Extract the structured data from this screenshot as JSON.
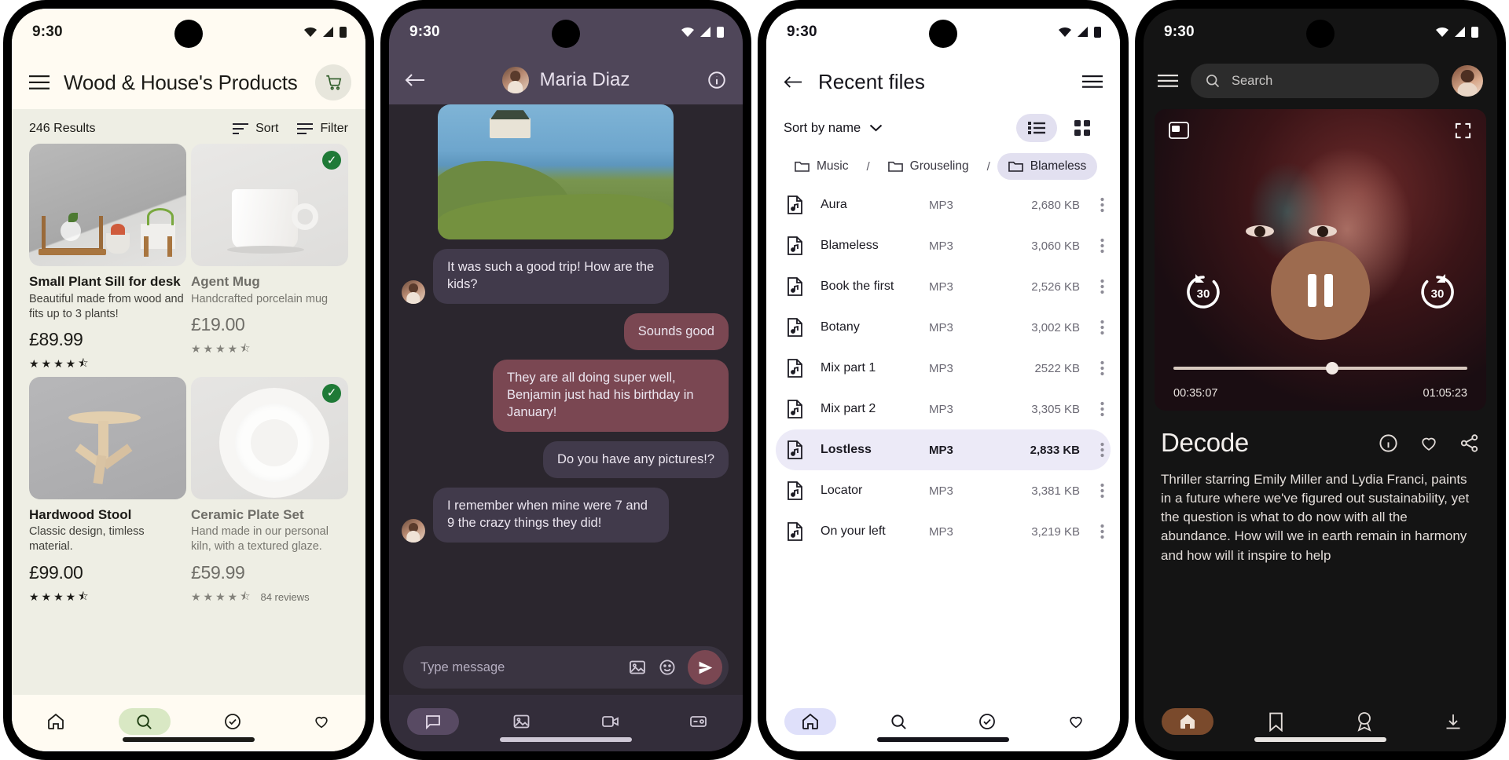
{
  "shop": {
    "status": {
      "time": "9:30"
    },
    "title": "Wood & House's Products",
    "cart_icon": "shopping-cart-icon",
    "menu_icon": "hamburger-menu-icon",
    "results_count": "246 Results",
    "sort_label": "Sort",
    "filter_label": "Filter",
    "products": [
      {
        "name": "Small Plant Sill for desk",
        "desc": "Beautiful made from wood and fits up to 3 plants!",
        "price": "£89.99",
        "stars": "★★★★",
        "half": "⯪",
        "selected": false,
        "reviews": ""
      },
      {
        "name": "Agent Mug",
        "desc": "Handcrafted porcelain mug",
        "price": "£19.00",
        "stars": "★★★★",
        "half": "⯪",
        "selected": true,
        "reviews": ""
      },
      {
        "name": "Hardwood Stool",
        "desc": "Classic design, timless material.",
        "price": "£99.00",
        "stars": "★★★★",
        "half": "⯪",
        "selected": false,
        "reviews": ""
      },
      {
        "name": "Ceramic Plate Set",
        "desc": "Hand made in our personal kiln, with a textured glaze.",
        "price": "£59.99",
        "stars": "★★★★",
        "half": "⯪",
        "selected": true,
        "reviews": "84 reviews"
      }
    ],
    "nav": [
      {
        "name": "home",
        "icon": "home-icon",
        "active": false
      },
      {
        "name": "search",
        "icon": "search-icon",
        "active": true
      },
      {
        "name": "orders",
        "icon": "check-circle-icon",
        "active": false
      },
      {
        "name": "favorites",
        "icon": "heart-icon",
        "active": false
      }
    ]
  },
  "chat": {
    "status": {
      "time": "9:30"
    },
    "contact": "Maria Diaz",
    "back_icon": "back-arrow-icon",
    "info_icon": "info-icon",
    "messages": [
      {
        "kind": "image",
        "side": "in"
      },
      {
        "kind": "text",
        "side": "in",
        "text": "It was such a good trip! How are the kids?"
      },
      {
        "kind": "text",
        "side": "out",
        "text": "Sounds good"
      },
      {
        "kind": "text",
        "side": "out",
        "text": "They are all doing super well, Benjamin just had his birthday in January!"
      },
      {
        "kind": "text",
        "side": "out",
        "text": "Do you have any pictures!?"
      },
      {
        "kind": "text",
        "side": "in",
        "text": "I remember when mine were 7 and 9 the crazy things they did!"
      }
    ],
    "composer": {
      "placeholder": "Type message",
      "image_icon": "image-icon",
      "emoji_icon": "emoji-icon",
      "send_icon": "send-icon"
    },
    "nav": [
      {
        "name": "chat",
        "icon": "chat-bubble-icon",
        "active": true
      },
      {
        "name": "photos",
        "icon": "image-icon",
        "active": false
      },
      {
        "name": "video",
        "icon": "video-camera-icon",
        "active": false
      },
      {
        "name": "payments",
        "icon": "wallet-icon",
        "active": false
      }
    ]
  },
  "files": {
    "status": {
      "time": "9:30"
    },
    "title": "Recent files",
    "back_icon": "back-arrow-icon",
    "menu_icon": "hamburger-menu-icon",
    "sort_label": "Sort by name",
    "sort_chevron": "chevron-down-icon",
    "view_list_icon": "list-view-icon",
    "view_grid_icon": "grid-view-icon",
    "view_mode": "list",
    "breadcrumbs": [
      {
        "label": "Music",
        "active": false
      },
      {
        "label": "Grouseling",
        "active": false
      },
      {
        "label": "Blameless",
        "active": true
      }
    ],
    "breadcrumb_sep": "/",
    "rows": [
      {
        "name": "Aura",
        "type": "MP3",
        "size": "2,680 KB",
        "selected": false
      },
      {
        "name": "Blameless",
        "type": "MP3",
        "size": "3,060 KB",
        "selected": false
      },
      {
        "name": "Book the first",
        "type": "MP3",
        "size": "2,526 KB",
        "selected": false
      },
      {
        "name": "Botany",
        "type": "MP3",
        "size": "3,002 KB",
        "selected": false
      },
      {
        "name": "Mix part 1",
        "type": "MP3",
        "size": "2522 KB",
        "selected": false
      },
      {
        "name": "Mix part 2",
        "type": "MP3",
        "size": "3,305 KB",
        "selected": false
      },
      {
        "name": "Lostless",
        "type": "MP3",
        "size": "2,833 KB",
        "selected": true
      },
      {
        "name": "Locator",
        "type": "MP3",
        "size": "3,381 KB",
        "selected": false
      },
      {
        "name": "On your left",
        "type": "MP3",
        "size": "3,219 KB",
        "selected": false
      }
    ],
    "row_more_icon": "more-vertical-icon",
    "file_icon": "music-file-icon",
    "folder_icon": "folder-icon",
    "nav": [
      {
        "name": "home",
        "icon": "home-icon",
        "active": true
      },
      {
        "name": "search",
        "icon": "search-icon",
        "active": false
      },
      {
        "name": "shared",
        "icon": "check-circle-icon",
        "active": false
      },
      {
        "name": "starred",
        "icon": "heart-icon",
        "active": false
      }
    ]
  },
  "player": {
    "status": {
      "time": "9:30"
    },
    "menu_icon": "hamburger-menu-icon",
    "search": {
      "placeholder": "Search",
      "icon": "search-icon"
    },
    "avatar_name": "user-avatar",
    "pip_icon": "picture-in-picture-icon",
    "fullscreen_icon": "fullscreen-icon",
    "rewind_label": "30",
    "forward_label": "30",
    "play_state": "pause",
    "current_time": "00:35:07",
    "total_time": "01:05:23",
    "progress_percent": 52,
    "title": "Decode",
    "actions": [
      {
        "name": "info",
        "icon": "info-icon"
      },
      {
        "name": "favorite",
        "icon": "heart-icon"
      },
      {
        "name": "share",
        "icon": "share-icon"
      }
    ],
    "synopsis": "Thriller starring Emily Miller and Lydia Franci, paints in a future where we've figured out sustainability, yet the question is what to do now with all the abundance. How will we in earth remain in harmony and how will it inspire to help",
    "nav": [
      {
        "name": "home",
        "icon": "home-icon",
        "active": true
      },
      {
        "name": "bookmarks",
        "icon": "bookmark-icon",
        "active": false
      },
      {
        "name": "awards",
        "icon": "medal-icon",
        "active": false
      },
      {
        "name": "downloads",
        "icon": "download-icon",
        "active": false
      }
    ]
  }
}
